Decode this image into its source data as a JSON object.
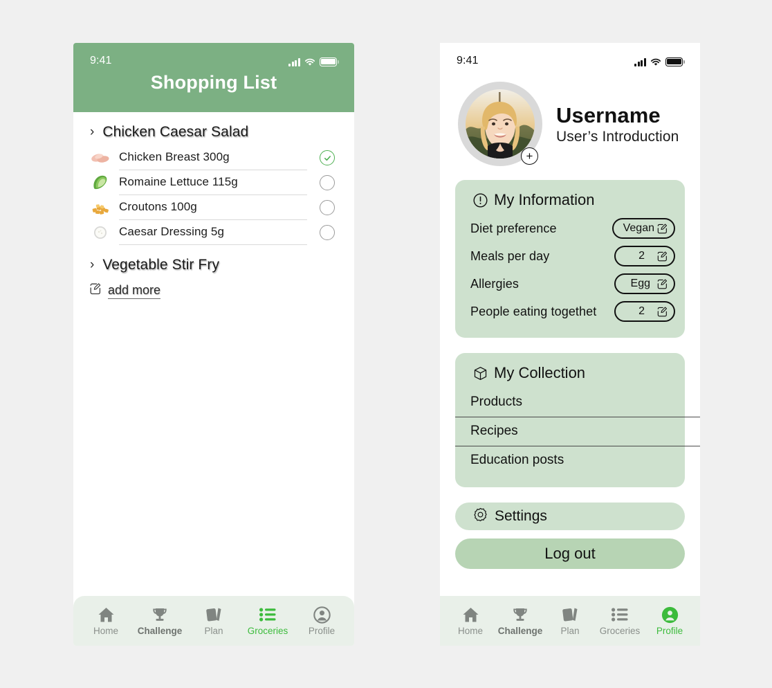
{
  "page": {
    "background": "#F0F0F0"
  },
  "colors": {
    "header_green": "#7CB083",
    "card_green": "#CEE1CE",
    "logout_green": "#B7D4B4",
    "tabbar_green": "#E9F0E9",
    "accent_green": "#3CBB3C",
    "check_green": "#4CAF50"
  },
  "phone_groceries": {
    "status": {
      "time": "9:41",
      "signal_icon": "cellular-bars-icon",
      "wifi_icon": "wifi-icon",
      "battery_icon": "battery-full-icon"
    },
    "header": {
      "title": "Shopping List"
    },
    "groups": [
      {
        "name": "Chicken Caesar Salad",
        "chevron": "chevron-right-icon",
        "expanded": true,
        "items": [
          {
            "thumb": "chicken-breast-thumb",
            "name": "Chicken Breast  300g",
            "checked": true
          },
          {
            "thumb": "romaine-lettuce-thumb",
            "name": "Romaine Lettuce 115g",
            "checked": false
          },
          {
            "thumb": "croutons-thumb",
            "name": "Croutons 100g",
            "checked": false
          },
          {
            "thumb": "caesar-dressing-thumb",
            "name": "Caesar Dressing 5g",
            "checked": false
          }
        ]
      },
      {
        "name": "Vegetable Stir Fry",
        "chevron": "chevron-right-icon",
        "expanded": false,
        "items": []
      }
    ],
    "add_more": {
      "label": "add more",
      "icon": "edit-pencil-icon"
    },
    "tabs": [
      {
        "label": "Home",
        "icon": "home-icon",
        "state": "normal"
      },
      {
        "label": "Challenge",
        "icon": "trophy-icon",
        "state": "bold"
      },
      {
        "label": "Plan",
        "icon": "cards-icon",
        "state": "normal"
      },
      {
        "label": "Groceries",
        "icon": "list-icon",
        "state": "active"
      },
      {
        "label": "Profile",
        "icon": "person-circle-icon",
        "state": "normal"
      }
    ]
  },
  "phone_profile": {
    "status": {
      "time": "9:41",
      "signal_icon": "cellular-bars-icon",
      "wifi_icon": "wifi-icon",
      "battery_icon": "battery-full-icon"
    },
    "header": {
      "avatar": "user-photo-avatar",
      "avatar_badge": "add-photo-plus-icon",
      "name": "Username",
      "subtitle": "User’s Introduction"
    },
    "information_card": {
      "icon": "exclamation-circle-icon",
      "title": "My Information",
      "rows": [
        {
          "label": "Diet preference",
          "value": "Vegan",
          "edit_icon": "edit-pencil-icon"
        },
        {
          "label": "Meals per day",
          "value": "2",
          "edit_icon": "edit-pencil-icon"
        },
        {
          "label": "Allergies",
          "value": "Egg",
          "edit_icon": "edit-pencil-icon"
        },
        {
          "label": "People eating togethet",
          "value": "2",
          "edit_icon": "edit-pencil-icon"
        }
      ]
    },
    "collection_card": {
      "icon": "cube-icon",
      "title": "My Collection",
      "rows": [
        {
          "label": "Products"
        },
        {
          "label": "Recipes"
        },
        {
          "label": "Education posts"
        }
      ]
    },
    "settings_button": {
      "icon": "gear-icon",
      "label": "Settings"
    },
    "logout_button": {
      "label": "Log out"
    },
    "tabs": [
      {
        "label": "Home",
        "icon": "home-icon",
        "state": "normal"
      },
      {
        "label": "Challenge",
        "icon": "trophy-icon",
        "state": "bold"
      },
      {
        "label": "Plan",
        "icon": "cards-icon",
        "state": "normal"
      },
      {
        "label": "Groceries",
        "icon": "list-icon",
        "state": "normal"
      },
      {
        "label": "Profile",
        "icon": "person-circle-icon",
        "state": "active"
      }
    ]
  }
}
